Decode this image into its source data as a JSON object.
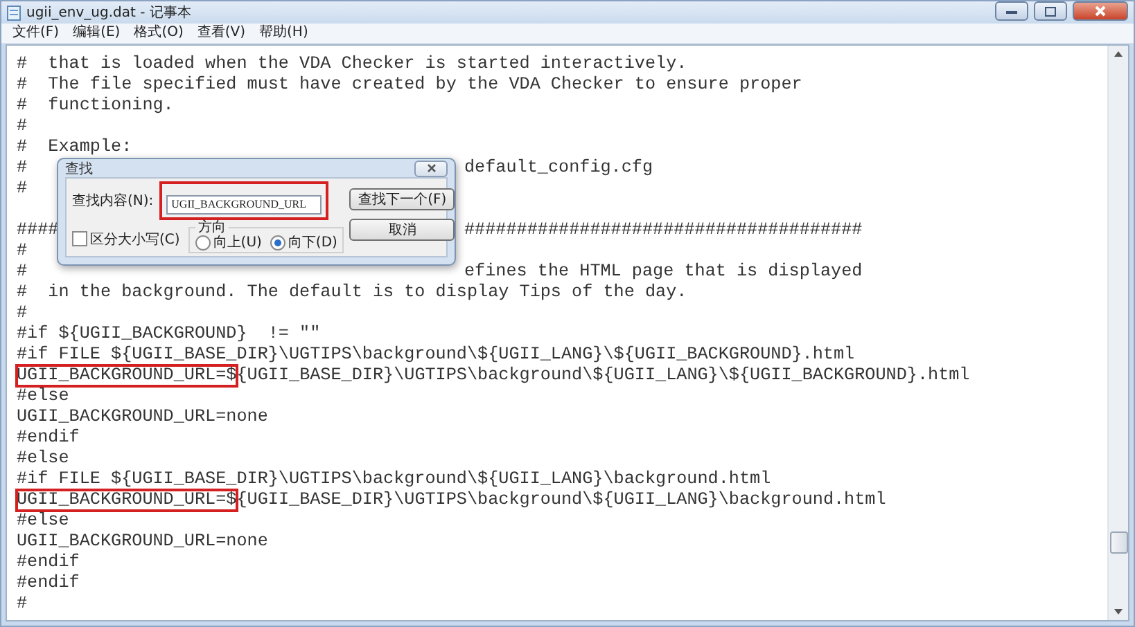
{
  "window": {
    "title": "ugii_env_ug.dat - 记事本"
  },
  "menu": [
    "文件(F)",
    "编辑(E)",
    "格式(O)",
    "查看(V)",
    "帮助(H)"
  ],
  "lines": [
    {
      "kind": "plain",
      "text": "#  that is loaded when the VDA Checker is started interactively."
    },
    {
      "kind": "plain",
      "text": "#  The file specified must have created by the VDA Checker to ensure proper"
    },
    {
      "kind": "plain",
      "text": "#  functioning."
    },
    {
      "kind": "plain",
      "text": "#"
    },
    {
      "kind": "plain",
      "text": "#  Example:"
    },
    {
      "kind": "split",
      "left": "#",
      "right": "default_config.cfg"
    },
    {
      "kind": "plain",
      "text": "#"
    },
    {
      "kind": "blank"
    },
    {
      "kind": "split",
      "left": "####",
      "right": "######################################"
    },
    {
      "kind": "plain",
      "text": "#"
    },
    {
      "kind": "split",
      "left": "#",
      "right": "efines the HTML page that is displayed"
    },
    {
      "kind": "plain",
      "text": "#  in the background. The default is to display Tips of the day."
    },
    {
      "kind": "plain",
      "text": "#"
    },
    {
      "kind": "plain",
      "text": "#if ${UGII_BACKGROUND}  != \"\""
    },
    {
      "kind": "plain",
      "text": "#if FILE ${UGII_BASE_DIR}\\UGTIPS\\background\\${UGII_LANG}\\${UGII_BACKGROUND}.html"
    },
    {
      "kind": "marked",
      "marked": "UGII_BACKGROUND_URL=$",
      "text": "{UGII_BASE_DIR}\\UGTIPS\\background\\${UGII_LANG}\\${UGII_BACKGROUND}.html"
    },
    {
      "kind": "plain",
      "text": "#else"
    },
    {
      "kind": "plain",
      "text": "UGII_BACKGROUND_URL=none"
    },
    {
      "kind": "plain",
      "text": "#endif"
    },
    {
      "kind": "plain",
      "text": "#else"
    },
    {
      "kind": "plain",
      "text": "#if FILE ${UGII_BASE_DIR}\\UGTIPS\\background\\${UGII_LANG}\\background.html"
    },
    {
      "kind": "marked",
      "marked": "UGII_BACKGROUND_URL=$",
      "text": "{UGII_BASE_DIR}\\UGTIPS\\background\\${UGII_LANG}\\background.html"
    },
    {
      "kind": "plain",
      "text": "#else"
    },
    {
      "kind": "plain",
      "text": "UGII_BACKGROUND_URL=none"
    },
    {
      "kind": "plain",
      "text": "#endif"
    },
    {
      "kind": "plain",
      "text": "#endif"
    },
    {
      "kind": "plain",
      "text": "#"
    }
  ],
  "dialog": {
    "title": "查找",
    "field": {
      "label": "查找内容(N):",
      "value": "UGII_BACKGROUND_URL",
      "highlighted": true
    },
    "buttons": [
      "查找下一个(F)",
      "取消"
    ],
    "match_case": {
      "label": "区分大小写(C)",
      "checked": false
    },
    "direction": {
      "label": "方向",
      "options": [
        {
          "label": "向上(U)",
          "selected": false
        },
        {
          "label": "向下(D)",
          "selected": true
        }
      ]
    }
  }
}
